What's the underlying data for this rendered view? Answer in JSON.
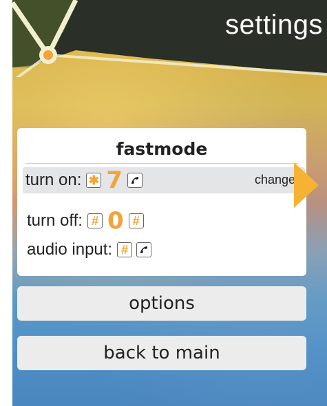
{
  "header": {
    "title": "settings"
  },
  "panel": {
    "title": "fastmode",
    "rows": [
      {
        "label": "turn on:",
        "digit": "7",
        "action": "change"
      },
      {
        "label": "turn off:",
        "digit": "0"
      },
      {
        "label": "audio input:"
      }
    ]
  },
  "buttons": {
    "options": "options",
    "back": "back to main"
  },
  "colors": {
    "accent_orange": "#f5a52a",
    "panel_bg": "#ffffff",
    "selected_row_bg": "#e4e5e7"
  },
  "icons": {
    "star_key": "star-key-icon",
    "hash_key": "hash-key-icon",
    "phone_key": "phone-key-icon",
    "arrow": "right-arrow-icon"
  }
}
